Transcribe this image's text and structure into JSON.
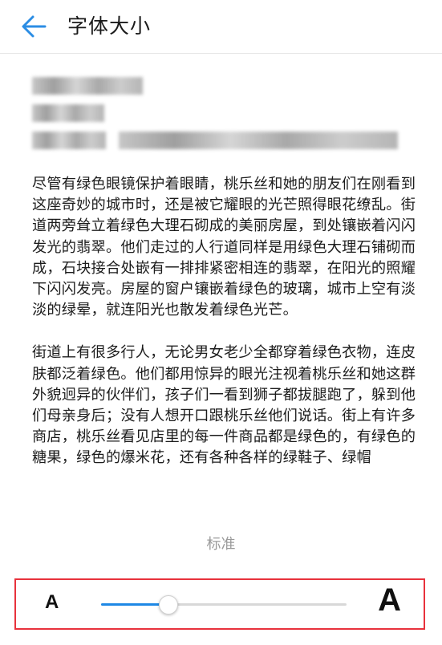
{
  "header": {
    "title": "字体大小",
    "back_icon": "arrow-left-icon",
    "accent": "#2b8de4"
  },
  "preview": {
    "paragraphs": [
      "尽管有绿色眼镜保护着眼睛，桃乐丝和她的朋友们在刚看到这座奇妙的城市时，还是被它耀眼的光芒照得眼花缭乱。街道两旁耸立着绿色大理石砌成的美丽房屋，到处镶嵌着闪闪发光的翡翠。他们走过的人行道同样是用绿色大理石铺砌而成，石块接合处嵌有一排排紧密相连的翡翠，在阳光的照耀下闪闪发亮。房屋的窗户镶嵌着绿色的玻璃，城市上空有淡淡的绿晕，就连阳光也散发着绿色光芒。",
      "街道上有很多行人，无论男女老少全都穿着绿色衣物，连皮肤都泛着绿色。他们都用惊异的眼光注视着桃乐丝和她这群外貌迥异的伙伴们，孩子们一看到狮子都拔腿跑了，躲到他们母亲身后；没有人想开口跟桃乐丝他们说话。街上有许多商店，桃乐丝看见店里的每一件商品都是绿色的，有绿色的糖果，绿色的爆米花，还有各种各样的绿鞋子、绿帽"
    ]
  },
  "font_size": {
    "level_label": "标准",
    "small_label": "A",
    "large_label": "A",
    "slider_value": 0.27,
    "fill_color": "#1e88e5",
    "highlight_color": "#e8323c"
  }
}
